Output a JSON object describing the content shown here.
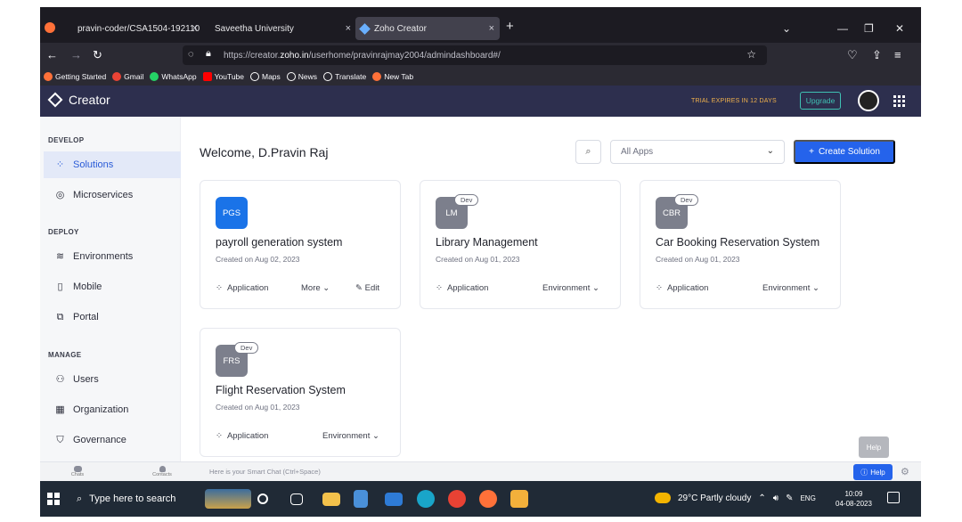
{
  "browser": {
    "tabs": [
      {
        "label": "pravin-coder/CSA1504-192110",
        "active": false
      },
      {
        "label": "Saveetha University",
        "active": false
      },
      {
        "label": "Zoho Creator",
        "active": true
      }
    ],
    "new_tab": "+",
    "url_prefix": "https://creator.",
    "url_host": "zoho.in",
    "url_path": "/userhome/pravinrajmay2004/admindashboard#/",
    "bookmarks": [
      "Getting Started",
      "Gmail",
      "WhatsApp",
      "YouTube",
      "Maps",
      "News",
      "Translate",
      "New Tab"
    ]
  },
  "header": {
    "product": "Creator",
    "trial": "TRIAL EXPIRES IN 12 DAYS",
    "upgrade": "Upgrade"
  },
  "sidebar": {
    "sections": [
      {
        "title": "DEVELOP",
        "items": [
          {
            "label": "Solutions",
            "active": true
          },
          {
            "label": "Microservices",
            "active": false
          }
        ]
      },
      {
        "title": "DEPLOY",
        "items": [
          {
            "label": "Environments"
          },
          {
            "label": "Mobile"
          },
          {
            "label": "Portal"
          }
        ]
      },
      {
        "title": "MANAGE",
        "items": [
          {
            "label": "Users"
          },
          {
            "label": "Organization"
          },
          {
            "label": "Governance"
          }
        ]
      }
    ]
  },
  "main": {
    "welcome": "Welcome, D.Pravin Raj",
    "filter": "All Apps",
    "create": "Create Solution",
    "cards": [
      {
        "badge": "PGS",
        "dev": "",
        "title": "payroll generation system",
        "created": "Created on Aug 02, 2023",
        "type": "Application",
        "action1": "More",
        "action2": "Edit"
      },
      {
        "badge": "LM",
        "dev": "Dev",
        "title": "Library Management",
        "created": "Created on Aug 01, 2023",
        "type": "Application",
        "action1": "Environment",
        "action2": ""
      },
      {
        "badge": "CBR",
        "dev": "Dev",
        "title": "Car Booking Reservation System",
        "created": "Created on Aug 01, 2023",
        "type": "Application",
        "action1": "Environment",
        "action2": ""
      },
      {
        "badge": "FRS",
        "dev": "Dev",
        "title": "Flight Reservation System",
        "created": "Created on Aug 01, 2023",
        "type": "Application",
        "action1": "Environment",
        "action2": ""
      }
    ]
  },
  "bottom": {
    "chats": "Chats",
    "contacts": "Contacts",
    "smart_chat": "Here is your Smart Chat (Ctrl+Space)",
    "help_tooltip": "Help",
    "help": "Help"
  },
  "taskbar": {
    "search": "Type here to search",
    "weather": "29°C  Partly cloudy",
    "lang": "ENG",
    "time": "10:09",
    "date": "04-08-2023"
  },
  "colors": {
    "accent": "#2563eb",
    "header_bg": "#2d2f4e",
    "pgs_badge": "#1a73e8",
    "dev_badge": "#7c7f8c"
  }
}
